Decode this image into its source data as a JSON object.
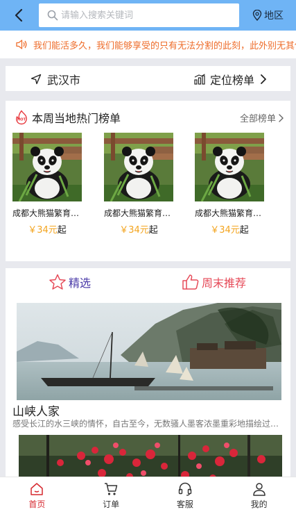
{
  "header": {
    "search_placeholder": "请输入搜索关键词",
    "region_label": "地区"
  },
  "notice": {
    "text": "我们能活多久，我们能够享受的只有无法分割的此刻，此外别无其他。"
  },
  "city_bar": {
    "city": "武汉市",
    "rank_label": "定位榜单"
  },
  "hot": {
    "title": "本周当地热门榜单",
    "badge": "HOT",
    "all_label": "全部榜单",
    "items": [
      {
        "name": "成都大熊猫繁育研究基地",
        "currency": "￥",
        "price": "34",
        "unit": "元",
        "suffix": "起"
      },
      {
        "name": "成都大熊猫繁育研究基地",
        "currency": "￥",
        "price": "34",
        "unit": "元",
        "suffix": "起"
      },
      {
        "name": "成都大熊猫繁育研究基地",
        "currency": "￥",
        "price": "34",
        "unit": "元",
        "suffix": "起"
      }
    ]
  },
  "recommend": {
    "tabs": [
      {
        "label": "精选"
      },
      {
        "label": "周末推荐"
      }
    ],
    "post": {
      "title": "山峡人家",
      "desc": "感受长江的水三峡的情怀，自古至今，无数骚人墨客浓墨重彩地描绘过这里的山山水水。"
    }
  },
  "tabbar": {
    "items": [
      {
        "label": "首页"
      },
      {
        "label": "订单"
      },
      {
        "label": "客服"
      },
      {
        "label": "我的"
      }
    ]
  },
  "colors": {
    "header_bg": "#6fb4f5",
    "notice_text": "#ee6d2b",
    "price": "#f3a41e",
    "tab_active": "#d6282f",
    "tab_featured": "#4a3aa8",
    "tab_weekend": "#e64a58"
  },
  "icons": {
    "back": "chevron-left-icon",
    "search": "search-icon",
    "region": "location-pin-icon",
    "notice": "speaker-icon",
    "city": "navigation-arrow-icon",
    "rank": "bar-chart-icon",
    "star": "star-icon",
    "thumb": "thumbs-up-icon"
  }
}
